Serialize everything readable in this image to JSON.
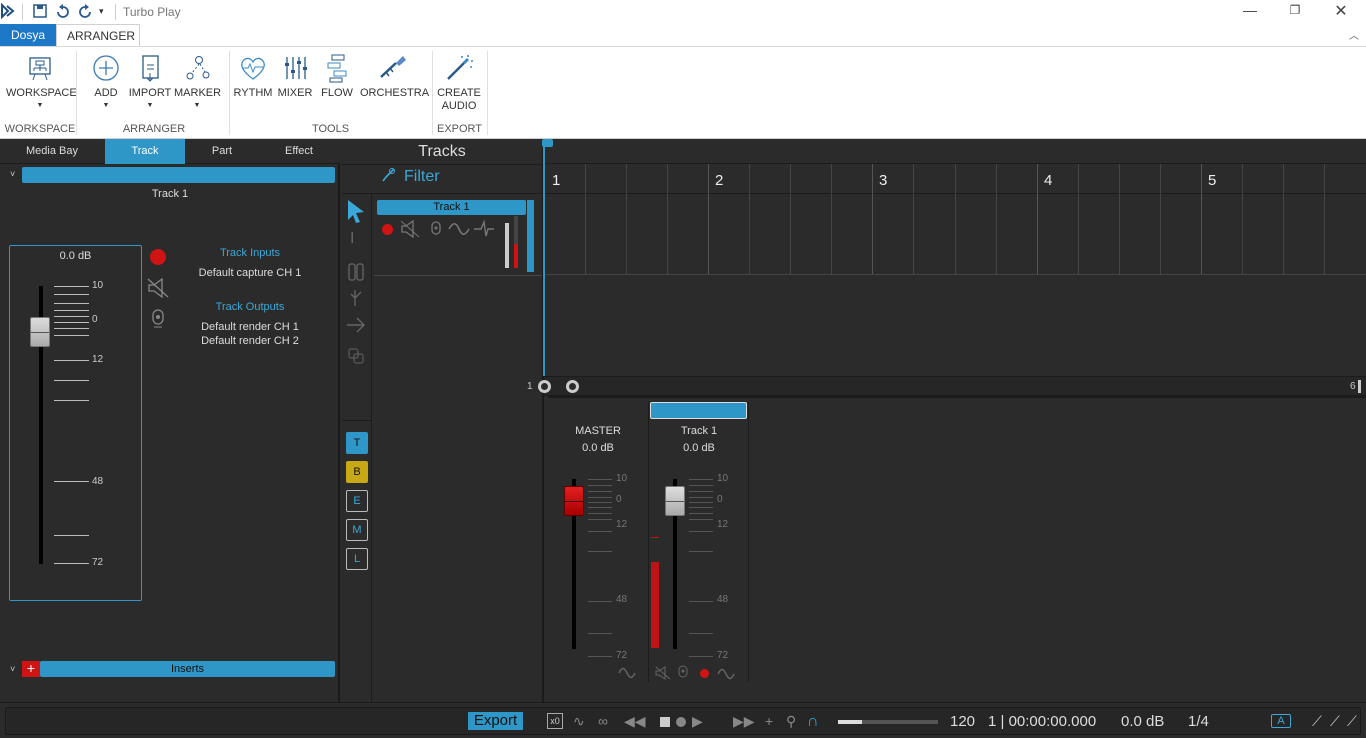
{
  "app": {
    "title": "Turbo Play"
  },
  "menu": {
    "file_tab": "Dosya",
    "arranger_tab": "ARRANGER"
  },
  "ribbon": {
    "buttons": {
      "workspace": "WORKSPACE",
      "add": "ADD",
      "import": "IMPORT",
      "marker": "MARKER",
      "rythm": "RYTHM",
      "mixer": "MIXER",
      "flow": "FLOW",
      "orchestra": "ORCHESTRA",
      "create_audio_1": "CREATE",
      "create_audio_2": "AUDIO"
    },
    "groups": {
      "workspace": "WORKSPACE",
      "arranger": "ARRANGER",
      "tools": "TOOLS",
      "export": "EXPORT"
    }
  },
  "left_panel": {
    "tabs": [
      "Media Bay",
      "Track",
      "Part",
      "Effect"
    ],
    "active_tab": "Track",
    "track_name": "Track 1",
    "fader_db": "0.0 dB",
    "fader_scale": [
      "10",
      "0",
      "12",
      "48",
      "72"
    ],
    "fader_level": 0.13,
    "inputs_title": "Track Inputs",
    "input_1": "Default capture CH 1",
    "outputs_title": "Track Outputs",
    "output_1": "Default render CH 1",
    "output_2": "Default render CH 2",
    "inserts": "Inserts"
  },
  "tracks_panel": {
    "title": "Tracks",
    "filter": "Filter",
    "track_label": "Track 1",
    "tool_buttons": [
      "T",
      "B",
      "E",
      "M",
      "L"
    ]
  },
  "timeline": {
    "bars": [
      "1",
      "2",
      "3",
      "4",
      "5"
    ],
    "zoom_start": "1",
    "zoom_end": "6"
  },
  "mixer": {
    "master": {
      "name": "MASTER",
      "db": "0.0 dB"
    },
    "track": {
      "name": "Track 1",
      "db": "0.0 dB"
    },
    "scale": [
      "10",
      "0",
      "12",
      "48",
      "72"
    ]
  },
  "status": {
    "export": "Export",
    "x0": "x0",
    "tempo": "120",
    "position": "1 | 00:00:00.000",
    "volume": "0.0 dB",
    "signature": "1/4"
  },
  "colors": {
    "accent": "#2f97c8",
    "record": "#d01414",
    "bg": "#2b2b2b"
  }
}
